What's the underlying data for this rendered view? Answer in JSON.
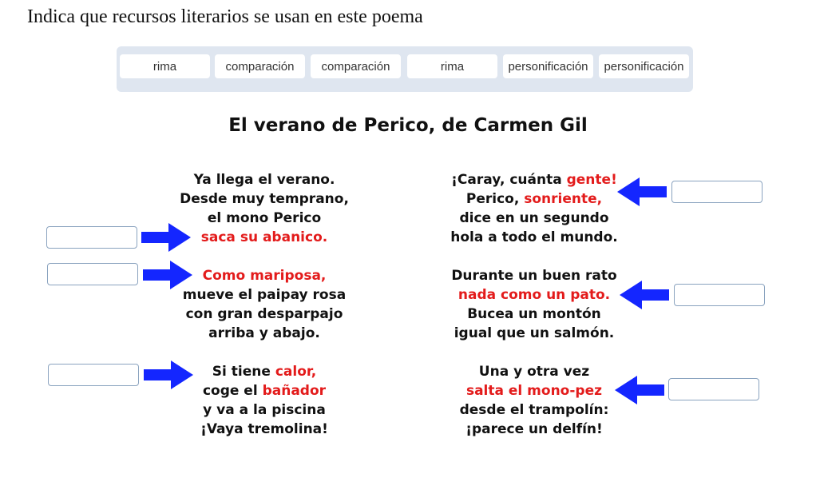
{
  "instruction": "Indica que recursos literarios se usan en este poema",
  "word_bank": [
    "rima",
    "comparación",
    "comparación",
    "rima",
    "personificación",
    "personificación"
  ],
  "poem": {
    "title": "El verano de Perico, de Carmen Gil",
    "stanzas": [
      {
        "lines": [
          [
            {
              "t": "Ya llega el verano."
            }
          ],
          [
            {
              "t": "Desde muy temprano,"
            }
          ],
          [
            {
              "t": "el mono Perico"
            }
          ],
          [
            {
              "t": "saca su abanico.",
              "red": true
            }
          ]
        ]
      },
      {
        "lines": [
          [
            {
              "t": "Como mariposa,",
              "red": true
            }
          ],
          [
            {
              "t": "mueve el paipay rosa"
            }
          ],
          [
            {
              "t": "con gran desparpajo"
            }
          ],
          [
            {
              "t": "arriba y abajo."
            }
          ]
        ]
      },
      {
        "lines": [
          [
            {
              "t": "Si tiene "
            },
            {
              "t": "calor,",
              "red": true
            }
          ],
          [
            {
              "t": "coge el "
            },
            {
              "t": "bañador",
              "red": true
            }
          ],
          [
            {
              "t": "y va a la piscina"
            }
          ],
          [
            {
              "t": "¡Vaya tremolina!"
            }
          ]
        ]
      },
      {
        "lines": [
          [
            {
              "t": "¡Caray, cuánta "
            },
            {
              "t": "gente!",
              "red": true
            }
          ],
          [
            {
              "t": "Perico, "
            },
            {
              "t": "sonriente,",
              "red": true
            }
          ],
          [
            {
              "t": "dice en un segundo"
            }
          ],
          [
            {
              "t": "hola a todo el mundo."
            }
          ]
        ]
      },
      {
        "lines": [
          [
            {
              "t": "Durante un buen rato"
            }
          ],
          [
            {
              "t": "nada como un pato.",
              "red": true
            }
          ],
          [
            {
              "t": "Bucea un montón"
            }
          ],
          [
            {
              "t": "igual que un salmón."
            }
          ]
        ]
      },
      {
        "lines": [
          [
            {
              "t": "Una y otra vez"
            }
          ],
          [
            {
              "t": "salta el mono-pez",
              "red": true
            }
          ],
          [
            {
              "t": "desde el trampolín:"
            }
          ],
          [
            {
              "t": "¡parece un delfín!"
            }
          ]
        ]
      }
    ]
  },
  "answers": [
    "",
    "",
    "",
    "",
    "",
    ""
  ],
  "colors": {
    "highlight": "#e31b1b",
    "arrow": "#1426ff",
    "word_bank_bg": "#dfe6f0",
    "drop_border": "#8aa3bf"
  },
  "icons": {
    "arrow_right": "arrow-right-icon",
    "arrow_left": "arrow-left-icon"
  }
}
